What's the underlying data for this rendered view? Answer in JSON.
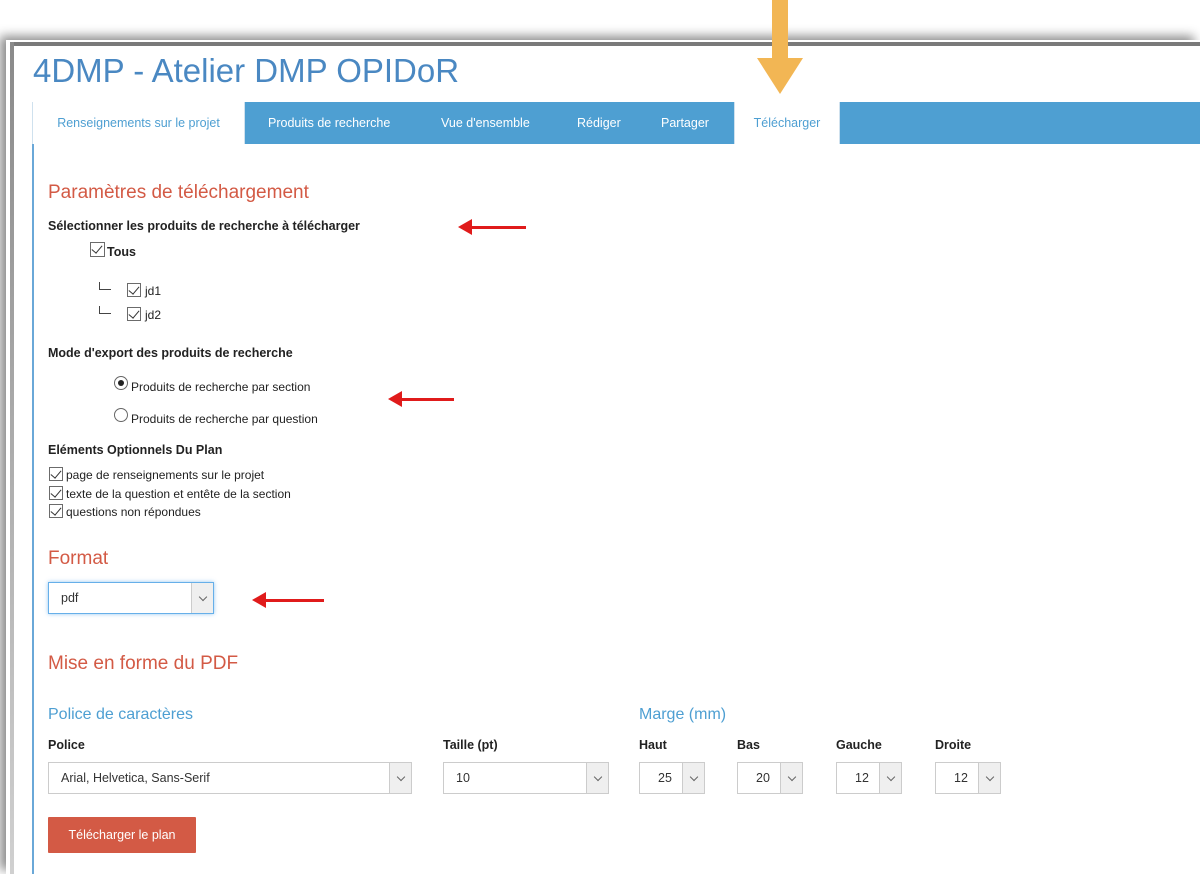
{
  "app": {
    "title": "4DMP - Atelier DMP OPIDoR"
  },
  "nav": {
    "tabs": [
      {
        "label": "Renseignements sur le projet"
      },
      {
        "label": "Produits de recherche"
      },
      {
        "label": "Vue d'ensemble"
      },
      {
        "label": "Rédiger"
      },
      {
        "label": "Partager"
      },
      {
        "label": "Télécharger",
        "active": true
      }
    ]
  },
  "download_params": {
    "heading": "Paramètres de téléchargement",
    "select_label": "Sélectionner les produits de recherche à télécharger",
    "all_label": "Tous",
    "all_checked": true,
    "products": [
      {
        "label": "jd1",
        "checked": true
      },
      {
        "label": "jd2",
        "checked": true
      }
    ]
  },
  "export_mode": {
    "label": "Mode d'export des produits de recherche",
    "options": [
      {
        "label": "Produits de recherche par section",
        "selected": true
      },
      {
        "label": "Produits de recherche par question",
        "selected": false
      }
    ]
  },
  "optional": {
    "label": "Eléments Optionnels Du Plan",
    "items": [
      {
        "label": "page de renseignements sur le projet",
        "checked": true
      },
      {
        "label": "texte de la question et entête de la section",
        "checked": true
      },
      {
        "label": "questions non répondues",
        "checked": true
      }
    ]
  },
  "format": {
    "heading": "Format",
    "value": "pdf"
  },
  "pdf": {
    "heading": "Mise en forme du PDF",
    "font_heading": "Police de caractères",
    "margin_heading": "Marge (mm)",
    "font_label": "Police",
    "font_value": "Arial, Helvetica, Sans-Serif",
    "size_label": "Taille (pt)",
    "size_value": "10",
    "margins": [
      {
        "label": "Haut",
        "value": "25"
      },
      {
        "label": "Bas",
        "value": "20"
      },
      {
        "label": "Gauche",
        "value": "12"
      },
      {
        "label": "Droite",
        "value": "12"
      }
    ]
  },
  "actions": {
    "download_label": "Télécharger le plan"
  },
  "colors": {
    "nav_blue": "#4e9fd2",
    "title_blue": "#4a88c2",
    "heading_red": "#d35a45",
    "button_red": "#d35a45",
    "annotation_red": "#e01b1b",
    "annotation_yellow": "#f2b654"
  }
}
